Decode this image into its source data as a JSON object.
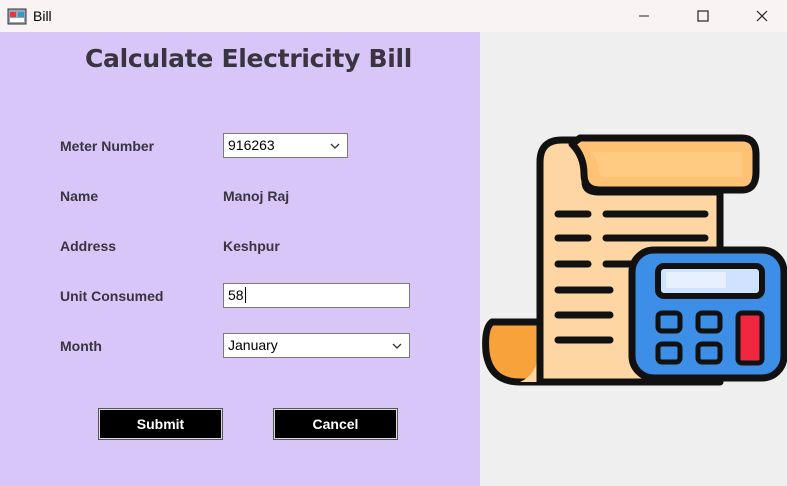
{
  "window": {
    "title": "Bill",
    "icon": "app-icon"
  },
  "heading": "Calculate Electricity Bill",
  "form": {
    "meter_number": {
      "label": "Meter Number",
      "selected": "916263"
    },
    "name": {
      "label": "Name",
      "value": "Manoj Raj"
    },
    "address": {
      "label": "Address",
      "value": "Keshpur"
    },
    "units": {
      "label": "Unit Consumed",
      "value": "58"
    },
    "month": {
      "label": "Month",
      "selected": "January"
    }
  },
  "buttons": {
    "submit": "Submit",
    "cancel": "Cancel"
  },
  "illustration": {
    "icon": "bill-calculator-icon"
  },
  "colors": {
    "left_panel": "#d7c6f7",
    "right_panel": "#efefef",
    "button": "#000000"
  }
}
